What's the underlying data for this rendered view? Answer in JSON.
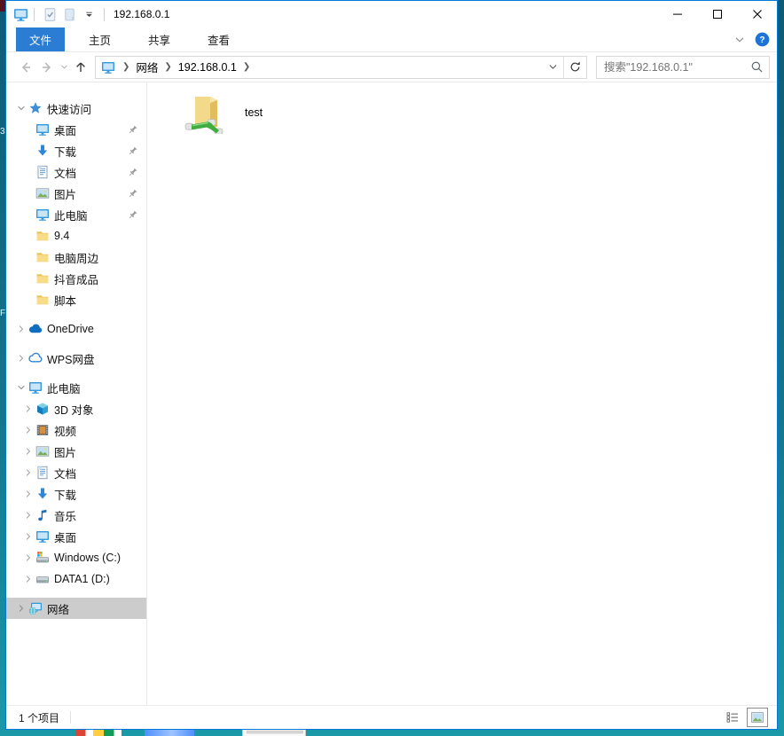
{
  "titlebar": {
    "title": "192.168.0.1",
    "qat_icon_names": [
      "computer-icon",
      "properties-icon",
      "new-item-icon",
      "customize-toolbar-icon"
    ]
  },
  "ribbon": {
    "tabs": [
      {
        "label": "文件",
        "active": true
      },
      {
        "label": "主页",
        "active": false
      },
      {
        "label": "共享",
        "active": false
      },
      {
        "label": "查看",
        "active": false
      }
    ]
  },
  "address_bar": {
    "crumbs": [
      "网络",
      "192.168.0.1"
    ],
    "search_placeholder": "搜索\"192.168.0.1\""
  },
  "sidebar": {
    "items": [
      {
        "label": "快速访问",
        "icon": "quick-access-star"
      },
      {
        "label": "桌面",
        "icon": "desktop-monitor",
        "pinned": true
      },
      {
        "label": "下载",
        "icon": "download-arrow",
        "pinned": true
      },
      {
        "label": "文档",
        "icon": "document",
        "pinned": true
      },
      {
        "label": "图片",
        "icon": "pictures",
        "pinned": true
      },
      {
        "label": "此电脑",
        "icon": "computer",
        "pinned": true
      },
      {
        "label": "9.4",
        "icon": "folder"
      },
      {
        "label": "电脑周边",
        "icon": "folder"
      },
      {
        "label": "抖音成品",
        "icon": "folder"
      },
      {
        "label": "脚本",
        "icon": "folder"
      },
      {
        "label": "OneDrive",
        "icon": "onedrive-cloud"
      },
      {
        "label": "WPS网盘",
        "icon": "wps-cloud"
      },
      {
        "label": "此电脑",
        "icon": "computer"
      },
      {
        "label": "3D 对象",
        "icon": "3d-cube"
      },
      {
        "label": "视频",
        "icon": "video-film"
      },
      {
        "label": "图片",
        "icon": "pictures"
      },
      {
        "label": "文档",
        "icon": "document"
      },
      {
        "label": "下载",
        "icon": "download-arrow"
      },
      {
        "label": "音乐",
        "icon": "music-note"
      },
      {
        "label": "桌面",
        "icon": "desktop-monitor"
      },
      {
        "label": "Windows (C:)",
        "icon": "windows-drive"
      },
      {
        "label": "DATA1 (D:)",
        "icon": "drive"
      },
      {
        "label": "网络",
        "icon": "network",
        "selected": true
      }
    ]
  },
  "content": {
    "items": [
      {
        "label": "test",
        "icon": "shared-network-folder"
      }
    ]
  },
  "status": {
    "count": "1 个项目"
  },
  "colors": {
    "accent_border": "#0078d7",
    "file_tab": "#2b7cd3",
    "selection_gray": "#cccccc",
    "desktop_backdrop_teal": "#1a99a8"
  }
}
